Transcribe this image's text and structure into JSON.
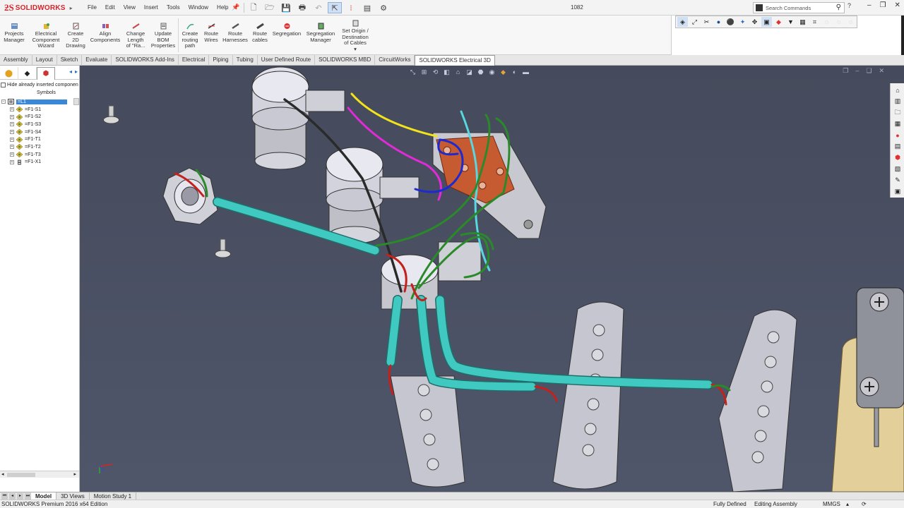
{
  "app": {
    "logo_text": "SOLIDWORKS",
    "document_title": "1082"
  },
  "menus": [
    "File",
    "Edit",
    "View",
    "Insert",
    "Tools",
    "Window",
    "Help"
  ],
  "search": {
    "placeholder": "Search Commands"
  },
  "ribbon": {
    "commands": [
      {
        "label": "Projects\nManager",
        "icon": "projects-manager-icon"
      },
      {
        "label": "Electrical\nComponent\nWizard",
        "icon": "component-wizard-icon"
      },
      {
        "label": "Create\n2D\nDrawing",
        "icon": "create-2d-drawing-icon"
      },
      {
        "label": "Align\nComponents",
        "icon": "align-components-icon"
      },
      {
        "label": "Change\nLength\nof \"Ra...",
        "icon": "change-length-icon"
      },
      {
        "label": "Update\nBOM\nProperties",
        "icon": "update-bom-icon"
      },
      {
        "label": "Create\nrouting\npath",
        "icon": "create-routing-path-icon"
      },
      {
        "label": "Route\nWires",
        "icon": "route-wires-icon"
      },
      {
        "label": "Route\nHarnesses",
        "icon": "route-harnesses-icon"
      },
      {
        "label": "Route\ncables",
        "icon": "route-cables-icon"
      },
      {
        "label": "Segregation",
        "icon": "segregation-icon"
      },
      {
        "label": "Segregation\nManager",
        "icon": "segregation-manager-icon"
      },
      {
        "label": "Set Origin /\nDestination\nof Cables",
        "icon": "set-origin-icon"
      }
    ]
  },
  "tabs": [
    "Assembly",
    "Layout",
    "Sketch",
    "Evaluate",
    "SOLIDWORKS Add-Ins",
    "Electrical",
    "Piping",
    "Tubing",
    "User Defined Route",
    "SOLIDWORKS MBD",
    "CircuitWorks",
    "SOLIDWORKS Electrical 3D"
  ],
  "active_tab": "SOLIDWORKS Electrical 3D",
  "left_panel": {
    "hide_checkbox_label": "Hide already inserted componen",
    "symbols_label": "Symbols",
    "tree_root": "=L1",
    "tree_children": [
      "=F1-S1",
      "=F1-S2",
      "=F1-S3",
      "=F1-S4",
      "=F1-T1",
      "=F1-T2",
      "=F1-T3",
      "=F1-X1"
    ]
  },
  "bottom_tabs": [
    "Model",
    "3D Views",
    "Motion Study 1"
  ],
  "active_bottom_tab": "Model",
  "status": {
    "edition": "SOLIDWORKS Premium 2016 x64 Edition",
    "definition": "Fully Defined",
    "mode": "Editing Assembly",
    "units": "MMGS"
  },
  "colors": {
    "brand_red": "#d8232a",
    "viewport_bg": "#4a5063",
    "cable_teal": "#3fc9c0",
    "wire_green": "#2f8a2f",
    "selection_blue": "#3a87d8"
  }
}
